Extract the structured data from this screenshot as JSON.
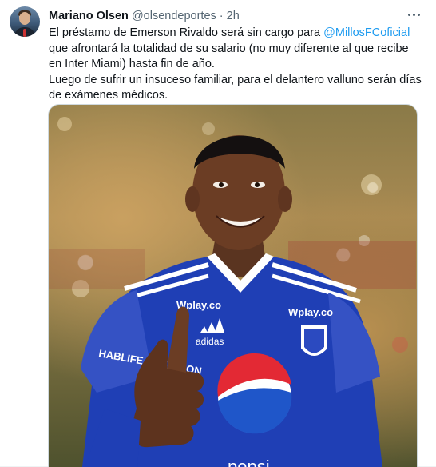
{
  "tweet": {
    "author_name": "Mariano Olsen",
    "author_handle": "@olsendeportes",
    "separator": "·",
    "time": "2h",
    "text_part1": "El préstamo de Emerson Rivaldo será sin cargo para ",
    "mention": "@MillosFCoficial",
    "text_part2": " que afrontará la totalidad de su salario (no muy diferente al que recibe en Inter Miami) hasta fin de año.",
    "text_para2": "Luego de sufrir un insuceso familiar, para el delantero valluno serán días de exámenes médicos."
  },
  "photo": {
    "jersey_sponsor_1": "Wplay.co",
    "jersey_sponsor_2": "Wplay.co",
    "jersey_brand": "adidas",
    "jersey_main_sponsor": "pepsi",
    "sleeve_text": "HABLIFE NUTRITION"
  },
  "colors": {
    "mention": "#1d9bf0",
    "jersey_blue": "#1f3fb5",
    "background": "#ffffff"
  },
  "icons": {
    "more": "more-horizontal-icon",
    "avatar": "author-avatar"
  }
}
